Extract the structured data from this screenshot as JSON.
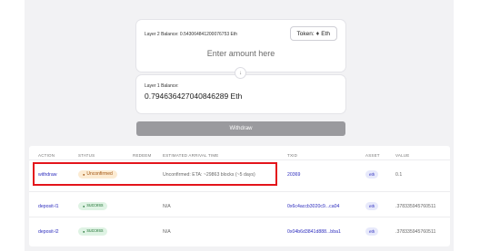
{
  "bridge": {
    "layer2_balance": "Layer 2 Balance: 0.543064841200076753 Eth",
    "token_label": "Token:",
    "token_symbol": "Eth",
    "amount_placeholder": "Enter amount here",
    "swap_arrow": "↓",
    "layer1_label": "Layer 1 Balance:",
    "layer1_value": "0.794636427040846289 Eth",
    "withdraw_label": "Withdraw"
  },
  "icons": {
    "eth": "ethereum-diamond-icon",
    "swap": "arrow-down-icon",
    "status_dot": "dot-icon"
  },
  "colors": {
    "highlight_border": "#e3141b",
    "link": "#2d2dbe",
    "unconfirmed_bg": "#fcebd2",
    "success_bg": "#dff3e4",
    "withdraw_button": "#9a9a9e"
  },
  "table": {
    "headers": [
      "ACTION",
      "STATUS",
      "REDEEM",
      "ESTIMATED ARRIVAL TIME",
      "TXID",
      "ASSET",
      "VALUE"
    ],
    "rows": [
      {
        "action": "withdraw",
        "status": "Unconfirmed",
        "redeem": "",
        "eta": "Unconfirmed: ETA: ~29863 blocks (~5 days)",
        "txid": "20369",
        "asset": "eth",
        "value": "0.1"
      },
      {
        "action": "deposit-l1",
        "status": "success",
        "redeem": "",
        "eta": "N/A",
        "txid": "0x6c4accb3020c9...ca04",
        "asset": "eth",
        "value": ".378335945760511"
      },
      {
        "action": "deposit-l2",
        "status": "success",
        "redeem": "",
        "eta": "N/A",
        "txid": "0x04b6d3841d888...bba1",
        "asset": "eth",
        "value": ".378335945760511"
      }
    ]
  }
}
